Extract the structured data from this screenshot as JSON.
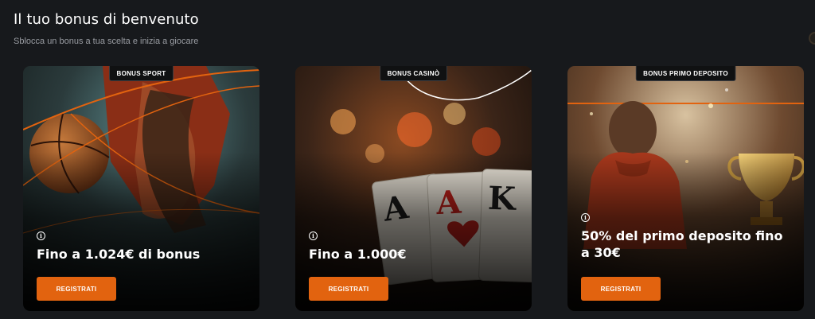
{
  "header": {
    "title": "Il tuo bonus di benvenuto",
    "subtitle": "Sblocca un bonus a tua scelta e inizia a giocare"
  },
  "cards": [
    {
      "tag": "BONUS SPORT",
      "info_glyph": "i",
      "headline": "Fino a 1.024€ di bonus",
      "button": "REGISTRATI"
    },
    {
      "tag": "BONUS CASINÒ",
      "info_glyph": "i",
      "headline": "Fino a 1.000€",
      "button": "REGISTRATI"
    },
    {
      "tag": "BONUS PRIMO DEPOSITO",
      "info_glyph": "i",
      "headline": "50% del primo deposito fino a 30€",
      "button": "REGISTRATI"
    }
  ],
  "colors": {
    "background": "#17191c",
    "accent": "#e2630f",
    "tag_background": "#101112"
  },
  "icons": {
    "info": "info-icon"
  }
}
